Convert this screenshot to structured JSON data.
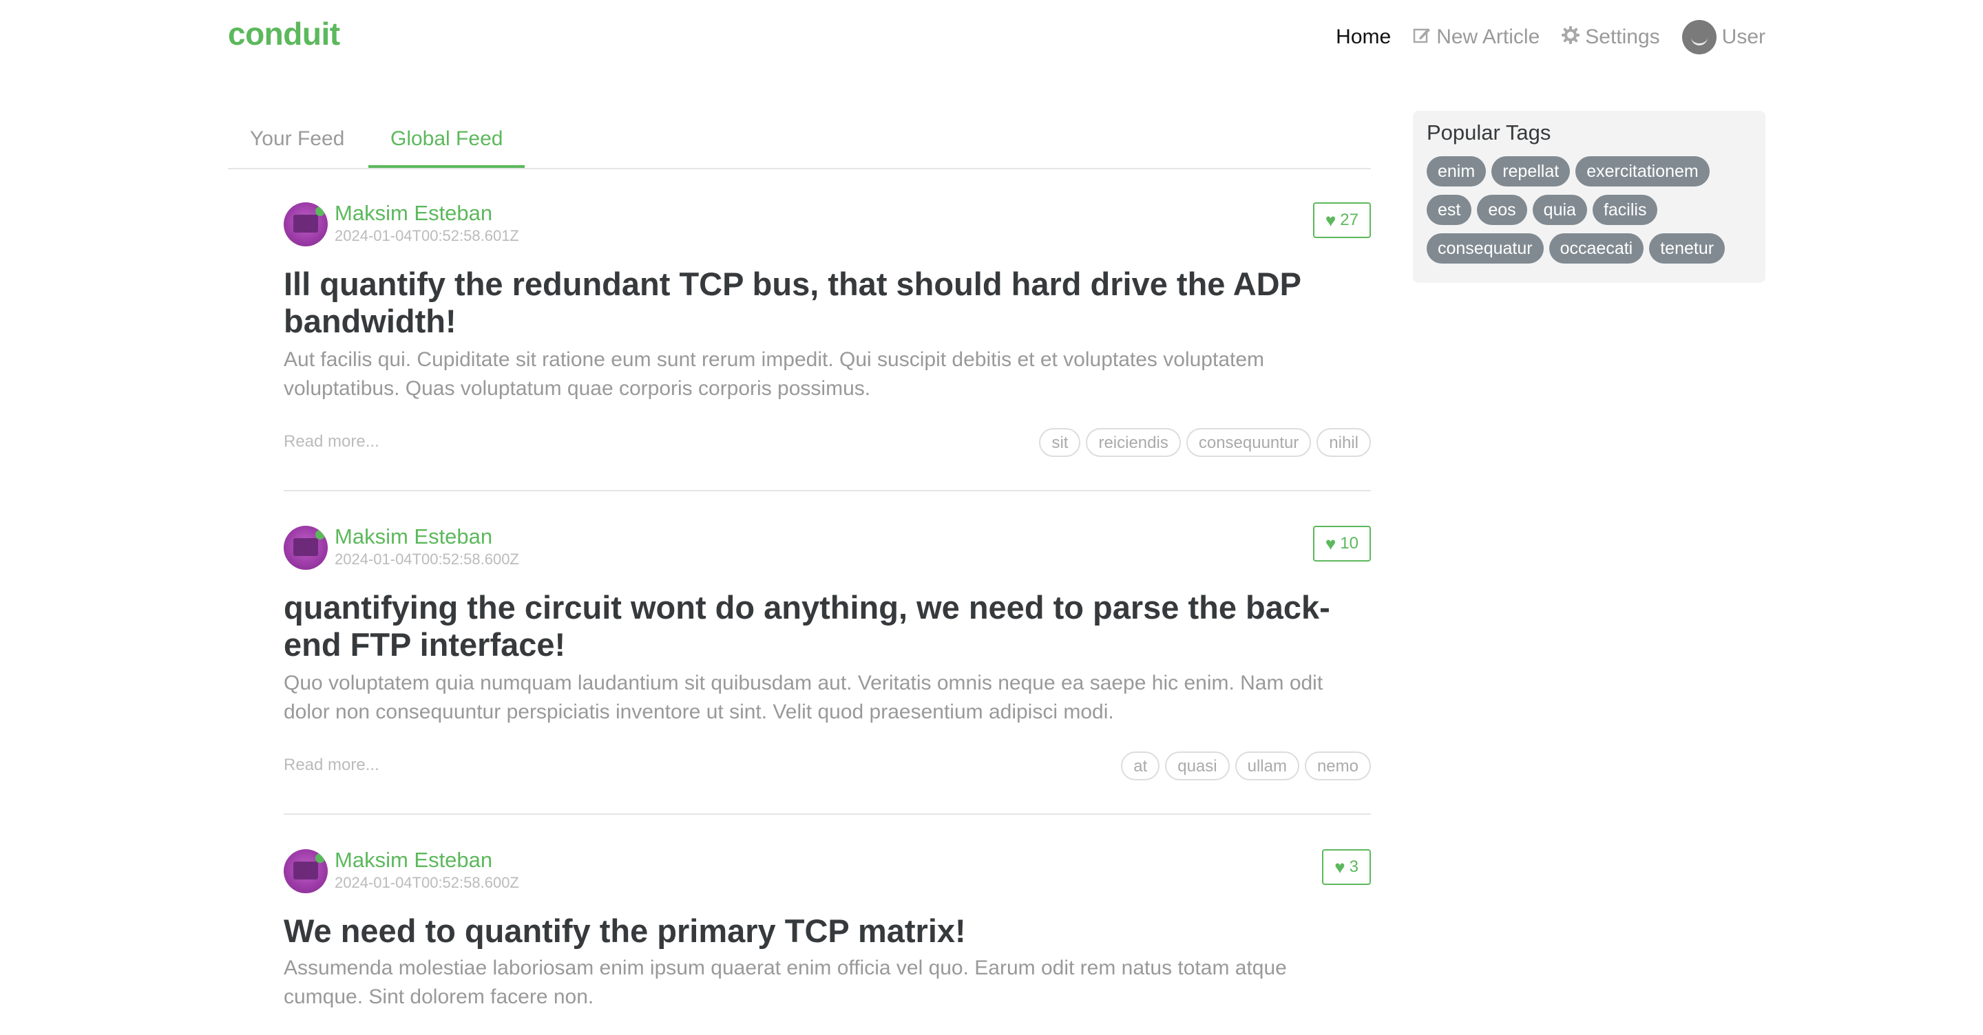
{
  "brand": "conduit",
  "nav": {
    "home": "Home",
    "new_article": "New Article",
    "settings": "Settings",
    "user": "User"
  },
  "feed_tabs": {
    "your_feed": "Your Feed",
    "global_feed": "Global Feed"
  },
  "articles": [
    {
      "author": "Maksim Esteban",
      "date": "2024-01-04T00:52:58.601Z",
      "likes": "27",
      "title": "Ill quantify the redundant TCP bus, that should hard drive the ADP bandwidth!",
      "description": "Aut facilis qui. Cupiditate sit ratione eum sunt rerum impedit. Qui suscipit debitis et et voluptates voluptatem voluptatibus. Quas voluptatum quae corporis corporis possimus.",
      "read_more": "Read more...",
      "tags": [
        "sit",
        "reiciendis",
        "consequuntur",
        "nihil"
      ]
    },
    {
      "author": "Maksim Esteban",
      "date": "2024-01-04T00:52:58.600Z",
      "likes": "10",
      "title": "quantifying the circuit wont do anything, we need to parse the back-end FTP interface!",
      "description": "Quo voluptatem quia numquam laudantium sit quibusdam aut. Veritatis omnis neque ea saepe hic enim. Nam odit dolor non consequuntur perspiciatis inventore ut sint. Velit quod praesentium adipisci modi.",
      "read_more": "Read more...",
      "tags": [
        "at",
        "quasi",
        "ullam",
        "nemo"
      ]
    },
    {
      "author": "Maksim Esteban",
      "date": "2024-01-04T00:52:58.600Z",
      "likes": "3",
      "title": "We need to quantify the primary TCP matrix!",
      "description": "Assumenda molestiae laboriosam enim ipsum quaerat enim officia vel quo. Earum odit rem natus totam atque cumque. Sint dolorem facere non."
    }
  ],
  "sidebar": {
    "title": "Popular Tags",
    "tags": [
      "enim",
      "repellat",
      "exercitationem",
      "est",
      "eos",
      "quia",
      "facilis",
      "consequatur",
      "occaecati",
      "tenetur"
    ]
  },
  "colors": {
    "brand_green": "#5cb85c",
    "tag_gray": "#818a91"
  },
  "icons": {
    "new_article": "edit-icon",
    "settings": "gear-icon",
    "like": "heart-icon"
  }
}
